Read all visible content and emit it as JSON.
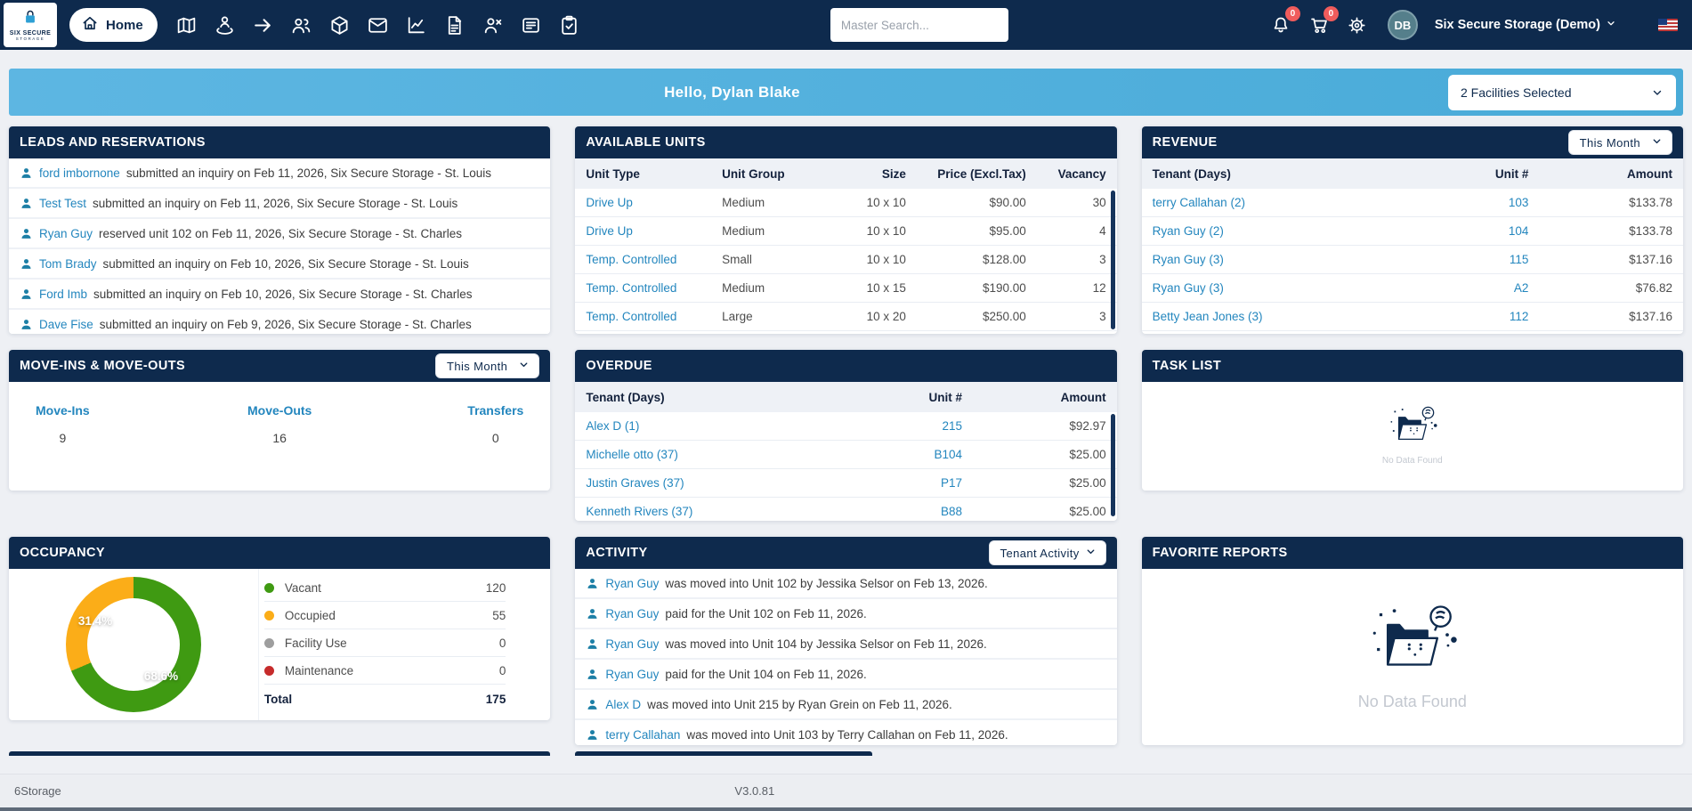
{
  "navbar": {
    "logo_line1": "SIX SECURE",
    "logo_line2": "STORAGE",
    "home_label": "Home",
    "search_placeholder": "Master Search...",
    "notification_badge": "0",
    "cart_badge": "0",
    "avatar_initials": "DB",
    "account_name": "Six Secure Storage (Demo)",
    "icons": [
      "map",
      "person-location",
      "move-out-arrow",
      "tenants",
      "units-cube",
      "mail",
      "reports-chart",
      "documents",
      "remove-tenant",
      "notes",
      "tasks-clipboard",
      "notifications-bell",
      "cart",
      "settings-gear",
      "us-flag"
    ]
  },
  "banner": {
    "greeting": "Hello, Dylan Blake",
    "facility_selector": "2 Facilities Selected"
  },
  "leads": {
    "title": "LEADS AND RESERVATIONS",
    "items": [
      {
        "name": "ford imbornone",
        "text": "submitted an inquiry on Feb 11, 2026, Six Secure Storage - St. Louis"
      },
      {
        "name": "Test Test",
        "text": "submitted an inquiry on Feb 11, 2026, Six Secure Storage - St. Louis"
      },
      {
        "name": "Ryan Guy",
        "text": "reserved unit 102 on Feb 11, 2026, Six Secure Storage - St. Charles"
      },
      {
        "name": "Tom Brady",
        "text": "submitted an inquiry on Feb 10, 2026, Six Secure Storage - St. Louis"
      },
      {
        "name": "Ford Imb",
        "text": "submitted an inquiry on Feb 10, 2026, Six Secure Storage - St. Charles"
      },
      {
        "name": "Dave Fise",
        "text": "submitted an inquiry on Feb 9, 2026, Six Secure Storage - St. Charles"
      }
    ]
  },
  "available_units": {
    "title": "AVAILABLE UNITS",
    "columns": {
      "unit_type": "Unit Type",
      "unit_group": "Unit Group",
      "size": "Size",
      "price": "Price (Excl.Tax)",
      "vacancy": "Vacancy"
    },
    "rows": [
      {
        "unit_type": "Drive Up",
        "unit_group": "Medium",
        "size": "10 x 10",
        "price": "$90.00",
        "vacancy": "30"
      },
      {
        "unit_type": "Drive Up",
        "unit_group": "Medium",
        "size": "10 x 10",
        "price": "$95.00",
        "vacancy": "4"
      },
      {
        "unit_type": "Temp. Controlled",
        "unit_group": "Small",
        "size": "10 x 10",
        "price": "$128.00",
        "vacancy": "3"
      },
      {
        "unit_type": "Temp. Controlled",
        "unit_group": "Medium",
        "size": "10 x 15",
        "price": "$190.00",
        "vacancy": "12"
      },
      {
        "unit_type": "Temp. Controlled",
        "unit_group": "Large",
        "size": "10 x 20",
        "price": "$250.00",
        "vacancy": "3"
      }
    ]
  },
  "revenue": {
    "title": "REVENUE",
    "filter": "This Month",
    "columns": {
      "tenant": "Tenant (Days)",
      "unit": "Unit #",
      "amount": "Amount"
    },
    "rows": [
      {
        "tenant": "terry Callahan (2)",
        "unit": "103",
        "amount": "$133.78"
      },
      {
        "tenant": "Ryan Guy (2)",
        "unit": "104",
        "amount": "$133.78"
      },
      {
        "tenant": "Ryan Guy (3)",
        "unit": "115",
        "amount": "$137.16"
      },
      {
        "tenant": "Ryan Guy (3)",
        "unit": "A2",
        "amount": "$76.82"
      },
      {
        "tenant": "Betty Jean Jones (3)",
        "unit": "112",
        "amount": "$137.16"
      }
    ]
  },
  "move_ins_outs": {
    "title": "MOVE-INS & MOVE-OUTS",
    "filter": "This Month",
    "stats": [
      {
        "label": "Move-Ins",
        "value": "9"
      },
      {
        "label": "Move-Outs",
        "value": "16"
      },
      {
        "label": "Transfers",
        "value": "0"
      }
    ]
  },
  "overdue": {
    "title": "OVERDUE",
    "columns": {
      "tenant": "Tenant (Days)",
      "unit": "Unit #",
      "amount": "Amount"
    },
    "rows": [
      {
        "tenant": "Alex D (1)",
        "unit": "215",
        "amount": "$92.97"
      },
      {
        "tenant": "Michelle otto (37)",
        "unit": "B104",
        "amount": "$25.00"
      },
      {
        "tenant": "Justin Graves (37)",
        "unit": "P17",
        "amount": "$25.00"
      },
      {
        "tenant": "Kenneth Rivers (37)",
        "unit": "B88",
        "amount": "$25.00"
      }
    ]
  },
  "task_list": {
    "title": "TASK LIST",
    "empty_text": "No Data Found"
  },
  "occupancy": {
    "title": "OCCUPANCY",
    "legend": [
      {
        "label": "Vacant",
        "value": "120",
        "color": "#3f9a12"
      },
      {
        "label": "Occupied",
        "value": "55",
        "color": "#fbad18"
      },
      {
        "label": "Facility Use",
        "value": "0",
        "color": "#9e9e9e"
      },
      {
        "label": "Maintenance",
        "value": "0",
        "color": "#c62b2b"
      }
    ],
    "total_label": "Total",
    "total_value": "175",
    "slice_label_minor": "31.4%",
    "slice_label_major": "68.6%"
  },
  "activity": {
    "title": "ACTIVITY",
    "filter": "Tenant Activity",
    "items": [
      {
        "name": "Ryan Guy",
        "text": "was moved into Unit 102 by Jessika Selsor on Feb 13, 2026."
      },
      {
        "name": "Ryan Guy",
        "text": "paid for the Unit 102 on Feb 11, 2026."
      },
      {
        "name": "Ryan Guy",
        "text": "was moved into Unit 104 by Jessika Selsor on Feb 11, 2026."
      },
      {
        "name": "Ryan Guy",
        "text": "paid for the Unit 104 on Feb 11, 2026."
      },
      {
        "name": "Alex D",
        "text": "was moved into Unit 215 by Ryan Grein on Feb 11, 2026."
      },
      {
        "name": "terry Callahan",
        "text": "was moved into Unit 103 by Terry Callahan on Feb 11, 2026."
      }
    ]
  },
  "favorite_reports": {
    "title": "FAVORITE REPORTS",
    "empty_text": "No Data Found"
  },
  "footer": {
    "brand": "6Storage",
    "version": "V3.0.81"
  },
  "chart_data": {
    "type": "pie",
    "title": "Occupancy",
    "labels": [
      "Vacant",
      "Occupied",
      "Facility Use",
      "Maintenance"
    ],
    "values": [
      120,
      55,
      0,
      0
    ],
    "percentages": [
      68.6,
      31.4,
      0,
      0
    ],
    "colors": [
      "#3f9a12",
      "#fbad18",
      "#9e9e9e",
      "#c62b2b"
    ],
    "total": 175,
    "donut": true,
    "legend_position": "right"
  }
}
